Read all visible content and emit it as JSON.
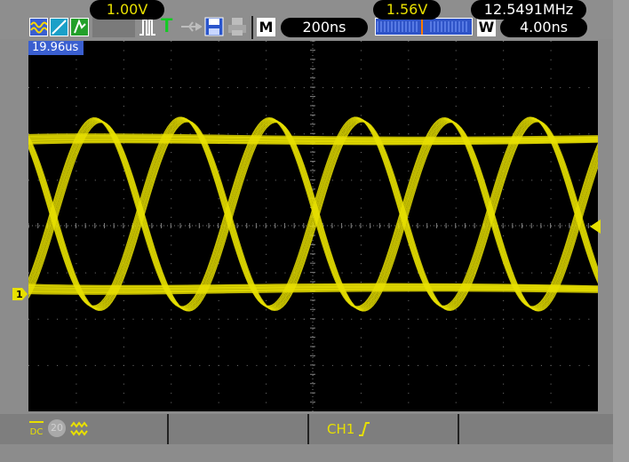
{
  "top": {
    "mode_letter": "M",
    "timebase": "200ns",
    "window_letter": "W",
    "window_timebase": "4.00ns",
    "trigger_letter": "T"
  },
  "screen": {
    "delay": "19.96us"
  },
  "bottom": {
    "coupling": "DC",
    "bw_limit": "20",
    "ch1_scale": "1.00V",
    "trigger_source": "CH1",
    "trigger_level": "1.56V",
    "frequency": "12.5491MHz"
  },
  "markers": {
    "channel": "1"
  },
  "colors": {
    "trace": "#e8e000",
    "grid": "#7a7a7a",
    "delay_tag": "#3a5fd0"
  }
}
